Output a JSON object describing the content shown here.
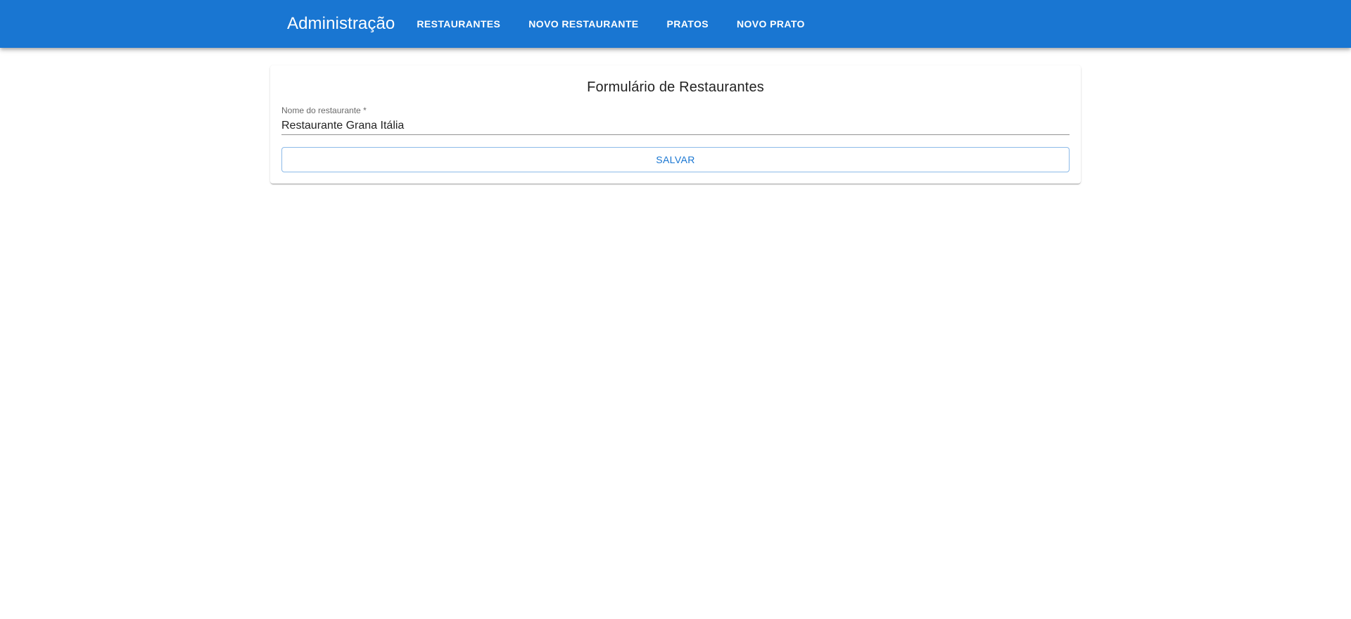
{
  "colors": {
    "primary": "#1976d2",
    "background": "#ffffff"
  },
  "header": {
    "title": "Administração",
    "nav": [
      {
        "label": "RESTAURANTES"
      },
      {
        "label": "NOVO RESTAURANTE"
      },
      {
        "label": "PRATOS"
      },
      {
        "label": "NOVO PRATO"
      }
    ]
  },
  "form": {
    "title": "Formulário de Restaurantes",
    "name_field": {
      "label": "Nome do restaurante *",
      "value": "Restaurante Grana Itália"
    },
    "save_label": "SALVAR"
  }
}
